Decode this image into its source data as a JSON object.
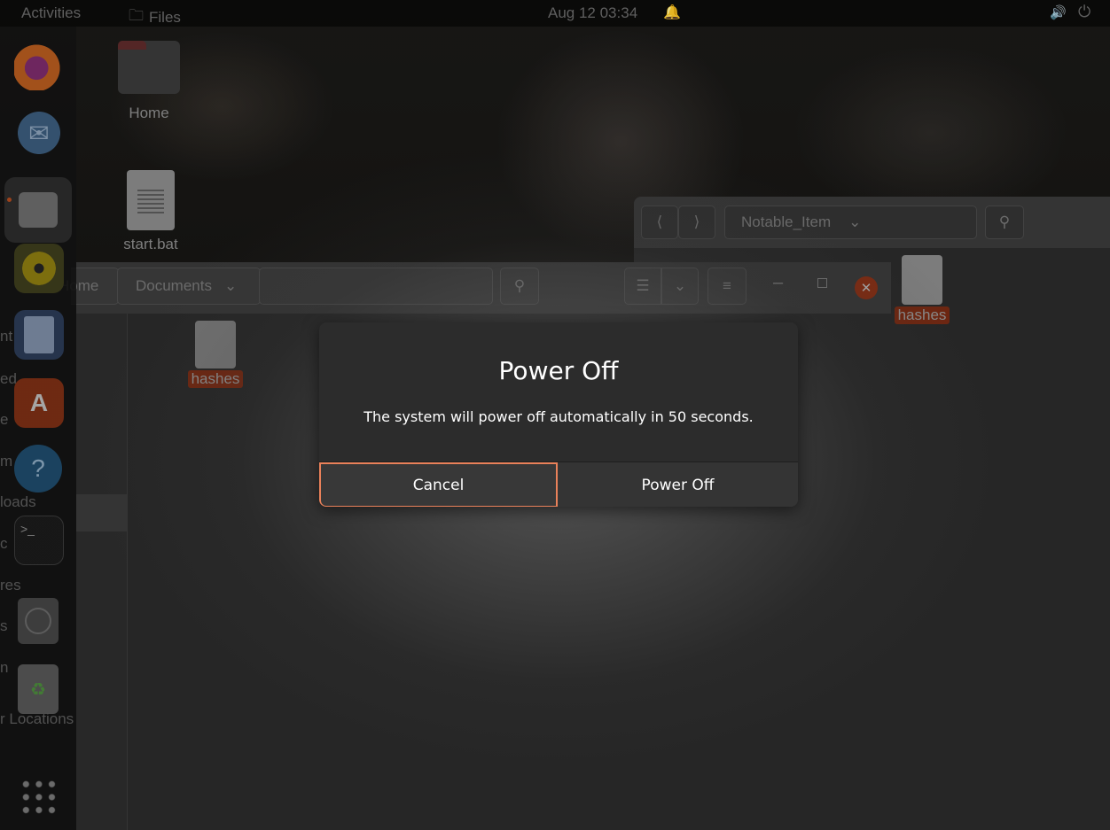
{
  "topbar": {
    "activities": "Activities",
    "app_name": "Files",
    "clock": "Aug 12  03:34"
  },
  "desktop": {
    "icons": [
      {
        "label": "Home"
      },
      {
        "label": "start.bat"
      }
    ]
  },
  "sidebar_ghost": {
    "labels": [
      "nt",
      "ed",
      "e",
      "m",
      "loads",
      "c",
      "res",
      "s",
      "n",
      "r Locations"
    ]
  },
  "bg_window": {
    "path_label": "Notable_Item",
    "file_label": "hashes"
  },
  "fg_window": {
    "home_label": "Home",
    "path_label": "Documents",
    "file_label": "hashes"
  },
  "dialog": {
    "title": "Power Off",
    "message": "The system will power off automatically in 50 seconds.",
    "cancel_label": "Cancel",
    "confirm_label": "Power Off",
    "countdown_seconds": 50
  },
  "colors": {
    "focus_ring": "#e9815a",
    "selection_label": "#e95420",
    "dialog_bg": "#2c2c2c"
  },
  "icons": {
    "bell": "bell-icon",
    "volume": "volume-icon",
    "power": "power-icon"
  }
}
